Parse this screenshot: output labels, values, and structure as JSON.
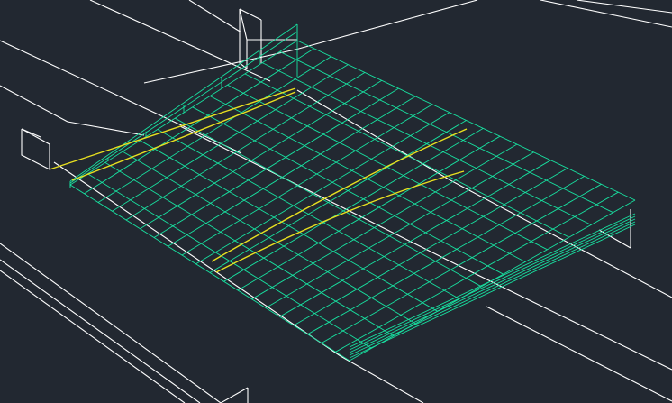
{
  "viewport": {
    "background": "#222831",
    "colors": {
      "wireframe": "#ffffff",
      "mesh": "#18e0a0",
      "curve": "#e8e020"
    }
  }
}
